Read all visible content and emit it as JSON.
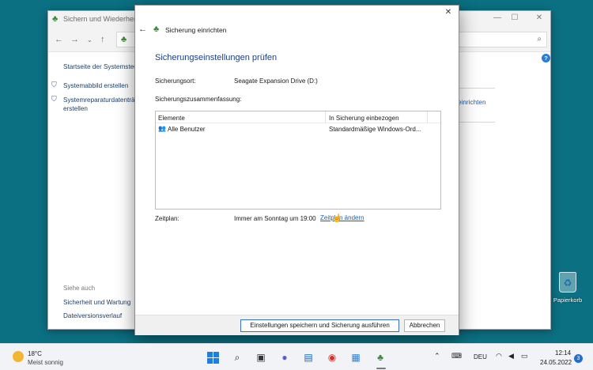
{
  "background_window": {
    "title": "Sichern und Wiederherste",
    "sidebar": {
      "home": "Startseite der Systemsteu",
      "system_image": "Systemabbild erstellen",
      "repair_disc_line1": "Systemreparaturdatenträ",
      "repair_disc_line2": "erstellen",
      "see_also": "Siehe auch",
      "security_maintenance": "Sicherheit und Wartung",
      "file_history": "Dateiversionsverlauf"
    },
    "right_link": "einrichten",
    "help": "?"
  },
  "dialog": {
    "title": "Sicherung einrichten",
    "heading": "Sicherungseinstellungen prüfen",
    "location_label": "Sicherungsort:",
    "location_value": "Seagate Expansion Drive (D:)",
    "summary_label": "Sicherungszusammenfassung:",
    "list": {
      "columns": [
        "Elemente",
        "In Sicherung einbezogen"
      ],
      "rows": [
        {
          "item": "Alle Benutzer",
          "included": "Standardmäßige Windows-Ord..."
        }
      ]
    },
    "schedule_label": "Zeitplan:",
    "schedule_value": "Immer am Sonntag um 19:00",
    "schedule_link": "Zeitplan ändern",
    "primary_button": "Einstellungen speichern und Sicherung ausführen",
    "cancel_button": "Abbrechen"
  },
  "desktop": {
    "recycle_bin": "Papierkorb"
  },
  "taskbar": {
    "weather_temp": "18°C",
    "weather_desc": "Meist sonnig",
    "language": "DEU",
    "time": "12:14",
    "date": "24.05.2022",
    "notifications": "3"
  }
}
